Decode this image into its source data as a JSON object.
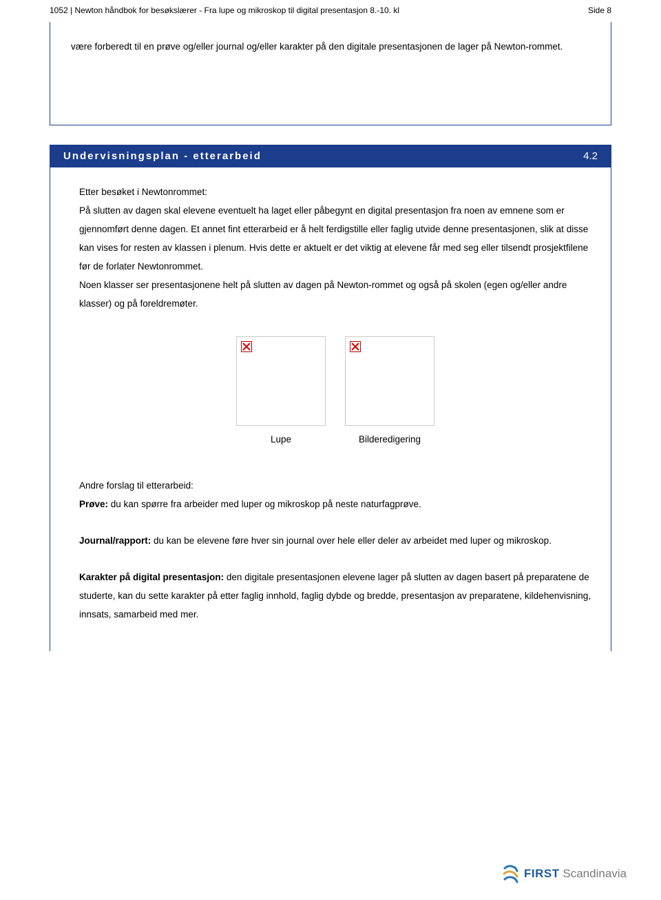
{
  "header": {
    "left": "1052 | Newton håndbok for besøkslærer - Fra lupe og mikroskop til digital presentasjon 8.-10. kl",
    "right": "Side 8"
  },
  "box1": {
    "text": "være forberedt til en prøve og/eller journal  og/eller karakter på den digitale presentasjonen de lager på Newton-rommet."
  },
  "section": {
    "title": "Undervisningsplan - etterarbeid",
    "number": "4.2"
  },
  "box2": {
    "intro": "Etter besøket i Newtonrommet:",
    "p1": "På slutten av dagen skal elevene eventuelt ha laget eller påbegynt en digital presentasjon fra noen av emnene som er gjennomført denne dagen. Et annet fint etterarbeid er å helt ferdigstille eller faglig utvide denne presentasjonen, slik at disse kan vises for resten av klassen i plenum. Hvis dette er aktuelt er det viktig at elevene får med seg eller tilsendt prosjektfilene før de forlater Newtonrommet.",
    "p2": "Noen klasser ser presentasjonene helt på slutten av dagen på Newton-rommet og også på skolen (egen og/eller andre klasser) og på foreldremøter.",
    "captions": {
      "c1": "Lupe",
      "c2": "Bilderedigering"
    },
    "other_heading": "Andre forslag til etterarbeid:",
    "prove_label": "Prøve:",
    "prove_text": " du kan spørre fra arbeider med luper og mikroskop på neste naturfagprøve.",
    "journal_label": "Journal/rapport:",
    "journal_text": " du kan be elevene føre hver sin journal over hele eller deler av arbeidet med luper og mikroskop.",
    "karakter_label": "Karakter på digital presentasjon:",
    "karakter_text": " den digitale presentasjonen elevene lager på slutten av dagen basert på preparatene de studerte, kan du sette karakter på etter faglig innhold, faglig dybde og bredde, presentasjon av preparatene, kildehenvisning, innsats, samarbeid med mer."
  },
  "footer": {
    "brand1": "FIRST",
    "brand2": " Scandinavia"
  }
}
